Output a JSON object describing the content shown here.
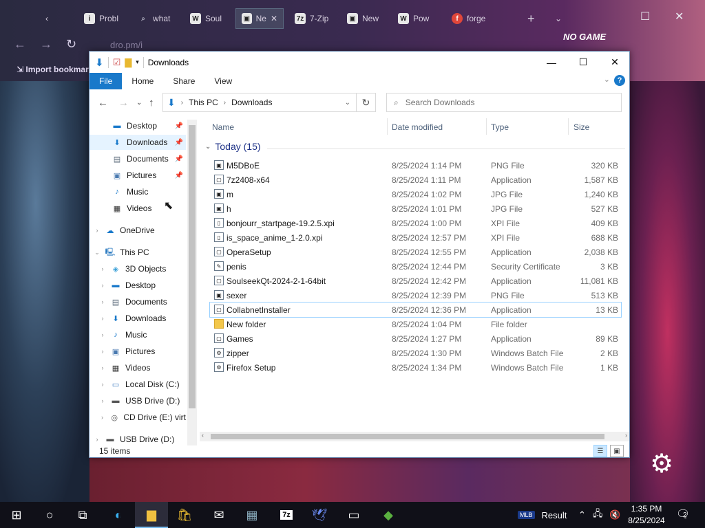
{
  "browser": {
    "tabs": [
      {
        "label": "Probl",
        "icon": "i"
      },
      {
        "label": "what",
        "icon": "search"
      },
      {
        "label": "Soul",
        "icon": "W"
      },
      {
        "label": "Ne",
        "icon": "img"
      },
      {
        "label": "7-Zip",
        "icon": "7z"
      },
      {
        "label": "New",
        "icon": "img"
      },
      {
        "label": "Pow",
        "icon": "W"
      },
      {
        "label": "forge",
        "icon": "f"
      }
    ],
    "url": "dro.pm/i",
    "bookmark_label": "Import bookmar",
    "overlay_text": "NO GAME"
  },
  "explorer": {
    "title": "Downloads",
    "ribbon_tabs": [
      "File",
      "Home",
      "Share",
      "View"
    ],
    "address": {
      "root": "This PC",
      "current": "Downloads"
    },
    "search_placeholder": "Search Downloads",
    "quick_access": [
      {
        "label": "Desktop",
        "icon": "desktop-icon",
        "pinned": true
      },
      {
        "label": "Downloads",
        "icon": "download-icon",
        "pinned": true,
        "selected": true
      },
      {
        "label": "Documents",
        "icon": "document-icon",
        "pinned": true
      },
      {
        "label": "Pictures",
        "icon": "pictures-icon",
        "pinned": true
      },
      {
        "label": "Music",
        "icon": "music-icon",
        "pinned": false
      },
      {
        "label": "Videos",
        "icon": "videos-icon",
        "pinned": false
      }
    ],
    "onedrive": "OneDrive",
    "this_pc": "This PC",
    "this_pc_children": [
      "3D Objects",
      "Desktop",
      "Documents",
      "Downloads",
      "Music",
      "Pictures",
      "Videos",
      "Local Disk (C:)",
      "USB Drive (D:)",
      "CD Drive (E:) virt"
    ],
    "bottom_item": "USB Drive (D:)",
    "columns": {
      "name": "Name",
      "date": "Date modified",
      "type": "Type",
      "size": "Size"
    },
    "group_label": "Today (15)",
    "files": [
      {
        "name": "M5DBoE",
        "date": "8/25/2024 1:14 PM",
        "type": "PNG File",
        "size": "320 KB"
      },
      {
        "name": "7z2408-x64",
        "date": "8/25/2024 1:11 PM",
        "type": "Application",
        "size": "1,587 KB"
      },
      {
        "name": "m",
        "date": "8/25/2024 1:02 PM",
        "type": "JPG File",
        "size": "1,240 KB"
      },
      {
        "name": "h",
        "date": "8/25/2024 1:01 PM",
        "type": "JPG File",
        "size": "527 KB"
      },
      {
        "name": "bonjourr_startpage-19.2.5.xpi",
        "date": "8/25/2024 1:00 PM",
        "type": "XPI File",
        "size": "409 KB"
      },
      {
        "name": "is_space_anime_1-2.0.xpi",
        "date": "8/25/2024 12:57 PM",
        "type": "XPI File",
        "size": "688 KB"
      },
      {
        "name": "OperaSetup",
        "date": "8/25/2024 12:55 PM",
        "type": "Application",
        "size": "2,038 KB"
      },
      {
        "name": "penis",
        "date": "8/25/2024 12:44 PM",
        "type": "Security Certificate",
        "size": "3 KB"
      },
      {
        "name": "SoulseekQt-2024-2-1-64bit",
        "date": "8/25/2024 12:42 PM",
        "type": "Application",
        "size": "11,081 KB"
      },
      {
        "name": "sexer",
        "date": "8/25/2024 12:39 PM",
        "type": "PNG File",
        "size": "513 KB"
      },
      {
        "name": "CollabnetInstaller",
        "date": "8/25/2024 12:36 PM",
        "type": "Application",
        "size": "13 KB"
      },
      {
        "name": "New folder",
        "date": "8/25/2024 1:04 PM",
        "type": "File folder",
        "size": ""
      },
      {
        "name": "Games",
        "date": "8/25/2024 1:27 PM",
        "type": "Application",
        "size": "89 KB"
      },
      {
        "name": "zipper",
        "date": "8/25/2024 1:30 PM",
        "type": "Windows Batch File",
        "size": "2 KB"
      },
      {
        "name": "Firefox Setup",
        "date": "8/25/2024 1:34 PM",
        "type": "Windows Batch File",
        "size": "1 KB"
      }
    ],
    "status": "15 items"
  },
  "taskbar": {
    "tray_label": "Result",
    "time": "1:35 PM",
    "date": "8/25/2024",
    "notifications": "2"
  },
  "colors": {
    "accent": "#1979ca",
    "taskbar": "#101018",
    "selection": "#e5f3ff"
  }
}
